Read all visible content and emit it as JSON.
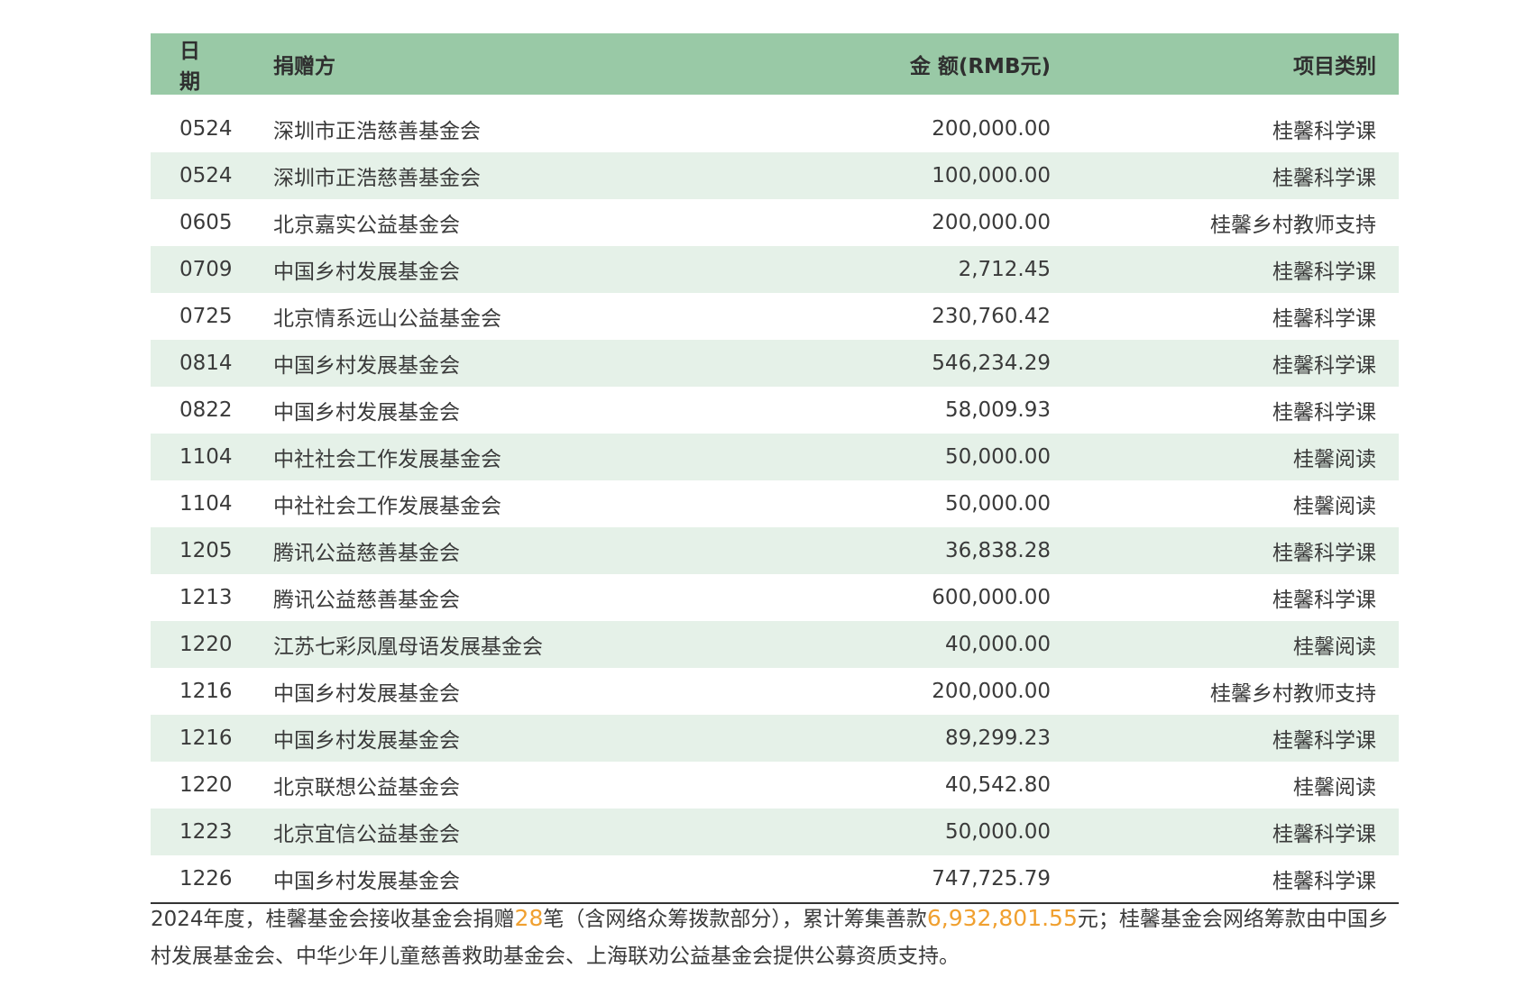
{
  "table": {
    "headers": {
      "date": "日 期",
      "donor": "捐赠方",
      "amount": "金 额(RMB元)",
      "category": "项目类别"
    },
    "rows": [
      {
        "date": "0524",
        "donor": "深圳市正浩慈善基金会",
        "amount": "200,000.00",
        "category": "桂馨科学课"
      },
      {
        "date": "0524",
        "donor": "深圳市正浩慈善基金会",
        "amount": "100,000.00",
        "category": "桂馨科学课"
      },
      {
        "date": "0605",
        "donor": "北京嘉实公益基金会",
        "amount": "200,000.00",
        "category": "桂馨乡村教师支持"
      },
      {
        "date": "0709",
        "donor": "中国乡村发展基金会",
        "amount": "2,712.45",
        "category": "桂馨科学课"
      },
      {
        "date": "0725",
        "donor": "北京情系远山公益基金会",
        "amount": "230,760.42",
        "category": "桂馨科学课"
      },
      {
        "date": "0814",
        "donor": "中国乡村发展基金会",
        "amount": "546,234.29",
        "category": "桂馨科学课"
      },
      {
        "date": "0822",
        "donor": "中国乡村发展基金会",
        "amount": "58,009.93",
        "category": "桂馨科学课"
      },
      {
        "date": "1104",
        "donor": "中社社会工作发展基金会",
        "amount": "50,000.00",
        "category": "桂馨阅读"
      },
      {
        "date": "1104",
        "donor": "中社社会工作发展基金会",
        "amount": "50,000.00",
        "category": "桂馨阅读"
      },
      {
        "date": "1205",
        "donor": "腾讯公益慈善基金会",
        "amount": "36,838.28",
        "category": "桂馨科学课"
      },
      {
        "date": "1213",
        "donor": "腾讯公益慈善基金会",
        "amount": "600,000.00",
        "category": "桂馨科学课"
      },
      {
        "date": "1220",
        "donor": "江苏七彩凤凰母语发展基金会",
        "amount": "40,000.00",
        "category": "桂馨阅读"
      },
      {
        "date": "1216",
        "donor": "中国乡村发展基金会",
        "amount": "200,000.00",
        "category": "桂馨乡村教师支持"
      },
      {
        "date": "1216",
        "donor": "中国乡村发展基金会",
        "amount": "89,299.23",
        "category": "桂馨科学课"
      },
      {
        "date": "1220",
        "donor": "北京联想公益基金会",
        "amount": "40,542.80",
        "category": "桂馨阅读"
      },
      {
        "date": "1223",
        "donor": "北京宜信公益基金会",
        "amount": "50,000.00",
        "category": "桂馨科学课"
      },
      {
        "date": "1226",
        "donor": "中国乡村发展基金会",
        "amount": "747,725.79",
        "category": "桂馨科学课"
      }
    ]
  },
  "footnote": {
    "part1": "2024年度，桂馨基金会接收基金会捐赠",
    "count": "28",
    "part2": "笔（含网络众筹拨款部分），累计筹集善款",
    "total": "6,932,801.55",
    "part3": "元；桂馨基金会网络筹款由中国乡村发展基金会、中华少年儿童慈善救助基金会、上海联劝公益基金会提供公募资质支持。"
  },
  "colors": {
    "header_bg": "#99c9a6",
    "alt_row_bg": "#e5f1e8",
    "highlight": "#f0a030"
  }
}
